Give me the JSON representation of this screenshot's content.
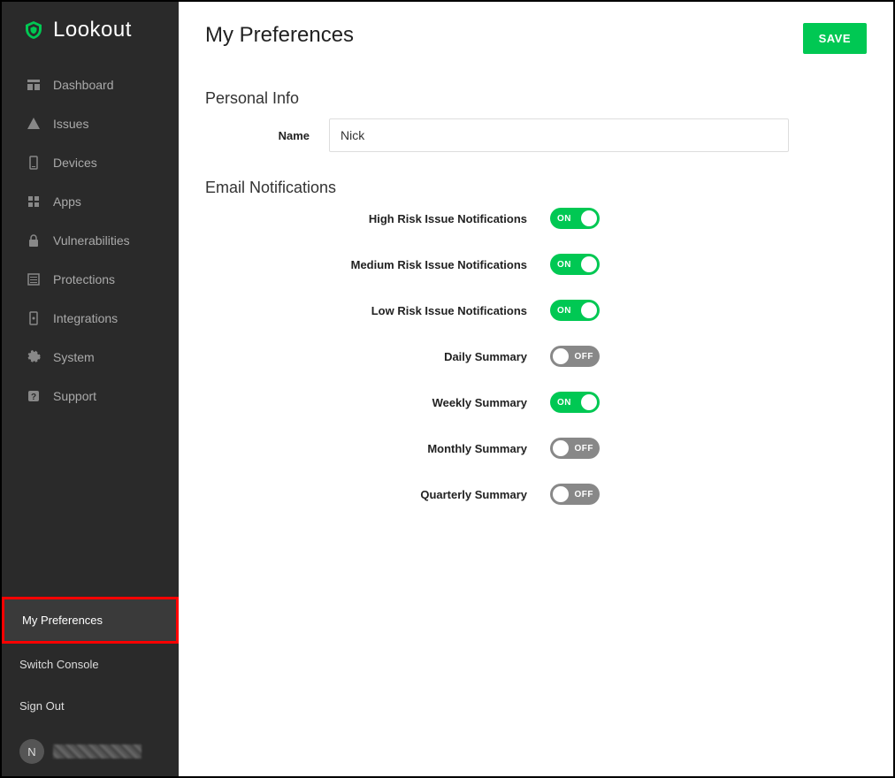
{
  "brand": {
    "name": "Lookout"
  },
  "sidebar": {
    "items": [
      {
        "label": "Dashboard",
        "icon": "dashboard-icon"
      },
      {
        "label": "Issues",
        "icon": "warning-icon"
      },
      {
        "label": "Devices",
        "icon": "device-icon"
      },
      {
        "label": "Apps",
        "icon": "apps-icon"
      },
      {
        "label": "Vulnerabilities",
        "icon": "lock-icon"
      },
      {
        "label": "Protections",
        "icon": "list-icon"
      },
      {
        "label": "Integrations",
        "icon": "plug-icon"
      },
      {
        "label": "System",
        "icon": "gear-icon"
      },
      {
        "label": "Support",
        "icon": "help-icon"
      }
    ],
    "bottom": [
      {
        "label": "My Preferences",
        "active": true
      },
      {
        "label": "Switch Console"
      },
      {
        "label": "Sign Out"
      }
    ],
    "user_initial": "N"
  },
  "page": {
    "title": "My Preferences",
    "save_label": "SAVE"
  },
  "personal_info": {
    "section_title": "Personal Info",
    "name_label": "Name",
    "name_value": "Nick"
  },
  "email_notifications": {
    "section_title": "Email Notifications",
    "settings": [
      {
        "label": "High Risk Issue Notifications",
        "on": true
      },
      {
        "label": "Medium Risk Issue Notifications",
        "on": true
      },
      {
        "label": "Low Risk Issue Notifications",
        "on": true
      },
      {
        "label": "Daily Summary",
        "on": false
      },
      {
        "label": "Weekly Summary",
        "on": true
      },
      {
        "label": "Monthly Summary",
        "on": false
      },
      {
        "label": "Quarterly Summary",
        "on": false
      }
    ],
    "on_text": "ON",
    "off_text": "OFF"
  }
}
